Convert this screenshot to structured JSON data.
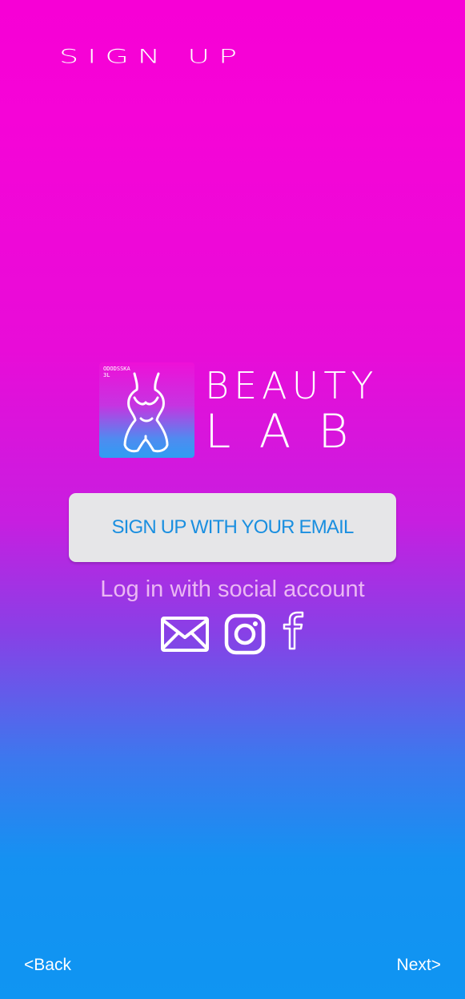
{
  "header": {
    "title": "SIGN UP"
  },
  "brand": {
    "line1": "BEAUTY",
    "line2": "LAB",
    "icon_caption": "ODODSSKA\n3L"
  },
  "actions": {
    "email_signup_label": "SIGN UP WITH YOUR EMAIL"
  },
  "social": {
    "label": "Log in with social account",
    "icons": [
      "mail-icon",
      "instagram-icon",
      "facebook-icon"
    ]
  },
  "footer": {
    "back_label": "<Back",
    "next_label": "Next>"
  },
  "colors": {
    "gradient_top": "#f700d6",
    "gradient_bottom": "#0f95f2",
    "button_bg": "#e6e6e8",
    "button_text": "#1a8fe0",
    "social_label": "#ebb8f3"
  }
}
